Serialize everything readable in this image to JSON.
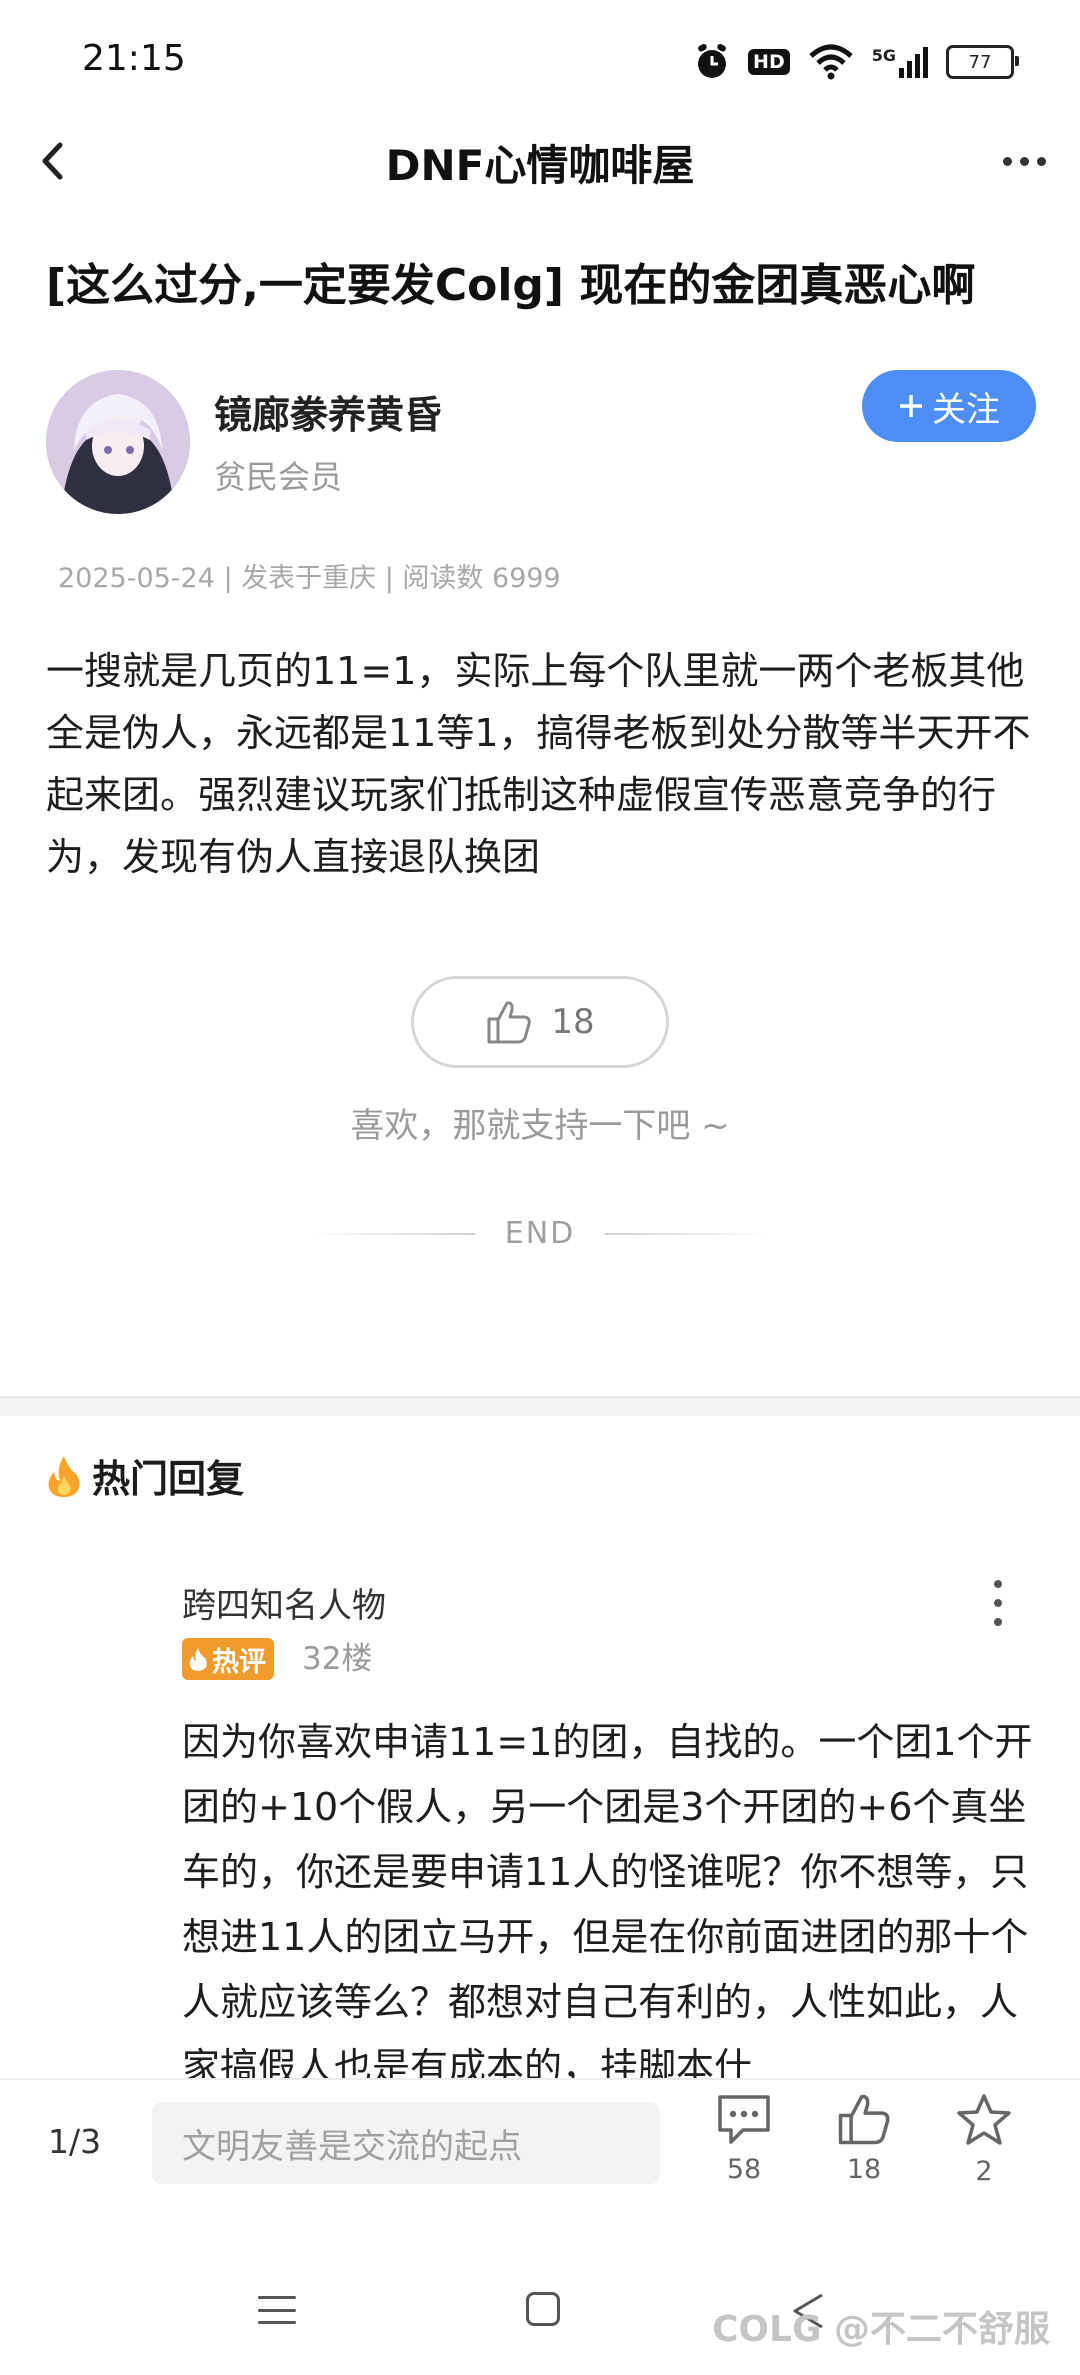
{
  "status_bar": {
    "time": "21:15",
    "network": "5G",
    "hd_label": "HD",
    "battery": "77",
    "icons": [
      "alarm-icon",
      "hd-icon",
      "wifi-icon",
      "signal-5g-icon",
      "battery-icon"
    ]
  },
  "nav": {
    "title": "DNF心情咖啡屋"
  },
  "post": {
    "title": "[这么过分,一定要发Colg] 现在的金团真恶心啊",
    "author": {
      "name": "镜廊豢养黄昏",
      "level": "贫民会员"
    },
    "follow_label": "关注",
    "follow_color": "#4d8ef5",
    "meta": "2025-05-24 | 发表于重庆 | 阅读数 6999",
    "body": "一搜就是几页的11=1，实际上每个队里就一两个老板其他全是伪人，永远都是11等1，搞得老板到处分散等半天开不起来团。强烈建议玩家们抵制这种虚假宣传恶意竞争的行为，发现有伪人直接退队换团",
    "likes": "18",
    "like_hint": "喜欢，那就支持一下吧 ~",
    "end_label": "END"
  },
  "hot_replies": {
    "section_title": "热门回复",
    "items": [
      {
        "user": "跨四知名人物",
        "badge": "热评",
        "badge_color": "#f29b2d",
        "floor": "32楼",
        "text": "因为你喜欢申请11=1的团，自找的。一个团1个开团的+10个假人，另一个团是3个开团的+6个真坐车的，你还是要申请11人的怪谁呢？你不想等，只想进11人的团立马开，但是在你前面进团的那十个人就应该等么？都想对自己有利的，人性如此，人家搞假人也是有成本的，挂脚本什"
      }
    ]
  },
  "bottom_bar": {
    "page_indicator": "1/3",
    "comment_placeholder": "文明友善是交流的起点",
    "comments_count": "58",
    "likes_count": "18",
    "favorites_count": "2"
  },
  "watermark": "COLG @不二不舒服"
}
